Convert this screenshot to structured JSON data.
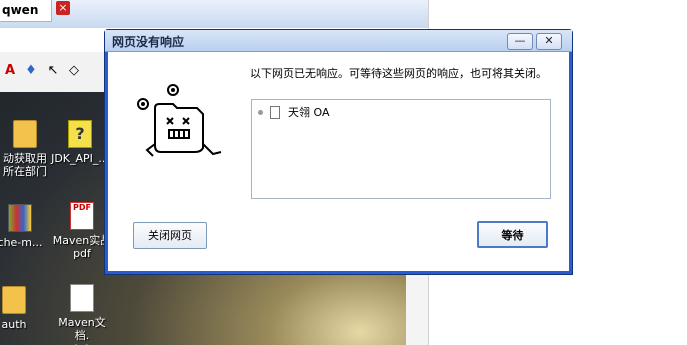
{
  "background_app": {
    "tab_label": "qwen",
    "tab_close_glyph": "×",
    "toolbar_icons": [
      "text-color-icon",
      "fill-icon",
      "pointer-icon",
      "eraser-icon"
    ],
    "toolbar_glyphs": [
      "A",
      "♦",
      "↖",
      "◇"
    ]
  },
  "desktop": {
    "icons": [
      {
        "label": "动获取用\n所在部门",
        "type": "document-icon"
      },
      {
        "label": "JDK_API_...",
        "type": "help-file-icon"
      },
      {
        "label": "che-m...",
        "type": "archive-icon"
      },
      {
        "label": "Maven实战\npdf",
        "type": "pdf-icon"
      },
      {
        "label": "auth",
        "type": "folder-icon"
      },
      {
        "label": "Maven文档.\ntxt",
        "type": "text-file-icon"
      }
    ]
  },
  "dialog": {
    "title": "网页没有响应",
    "minimize_glyph": "—",
    "close_glyph": "✕",
    "message": "以下网页已无响应。可等待这些网页的响应，也可将其关闭。",
    "pages": [
      "天翎 OA"
    ],
    "close_button": "关闭网页",
    "wait_button": "等待"
  },
  "colors": {
    "dialog_frame": "#2b5bd0",
    "accent_button_border": "#4a7ac9"
  }
}
